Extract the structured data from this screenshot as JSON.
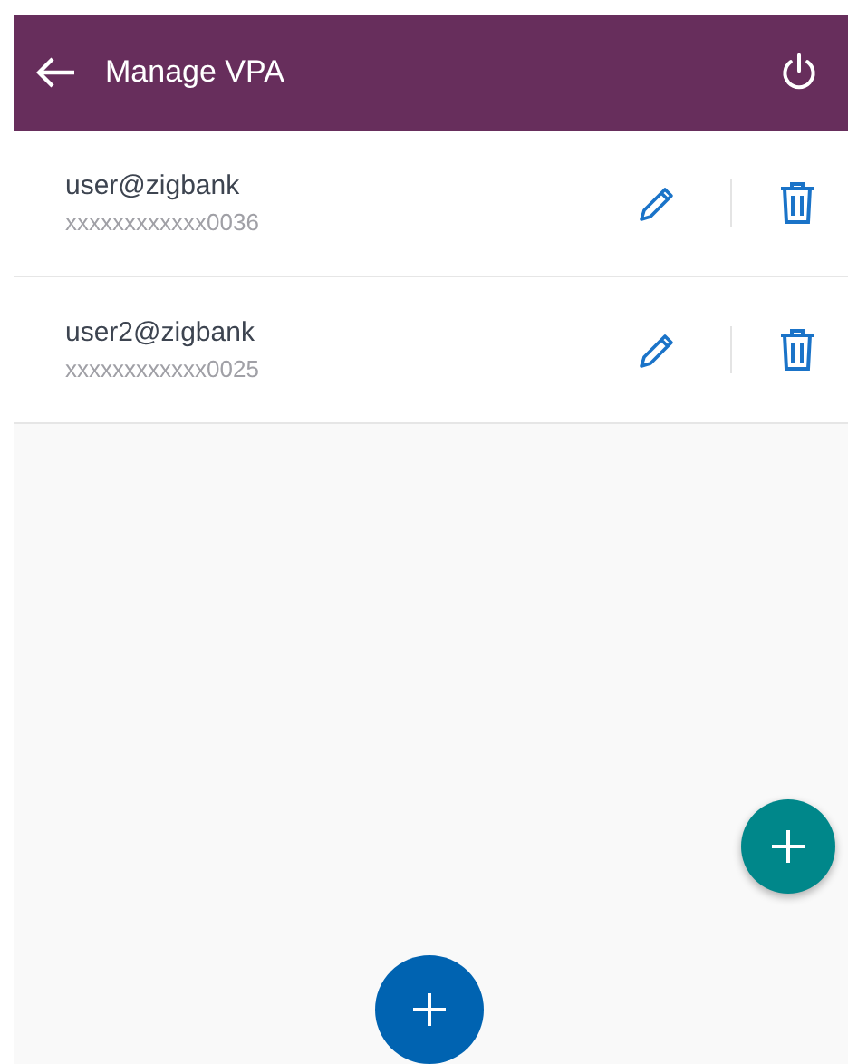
{
  "header": {
    "title": "Manage VPA"
  },
  "vpas": [
    {
      "address": "user@zigbank",
      "account": "xxxxxxxxxxxx0036"
    },
    {
      "address": "user2@zigbank",
      "account": "xxxxxxxxxxxx0025"
    }
  ]
}
